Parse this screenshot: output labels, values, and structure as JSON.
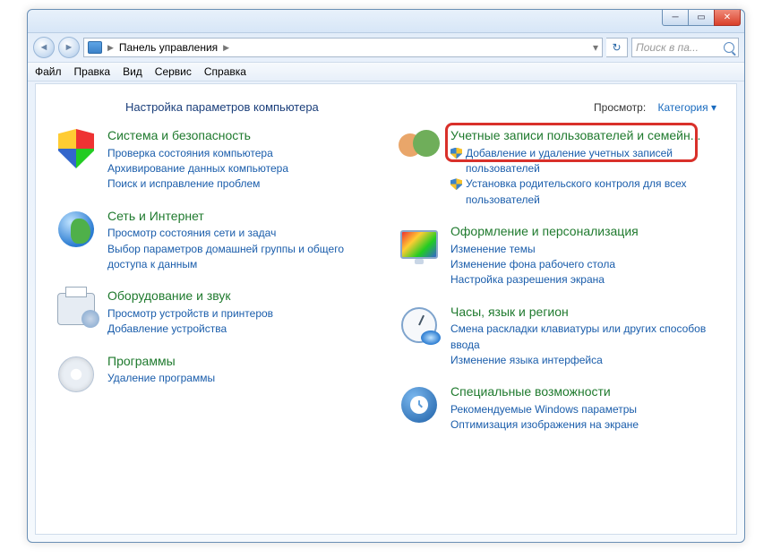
{
  "window": {
    "breadcrumb_title": "Панель управления",
    "search_placeholder": "Поиск в па..."
  },
  "menu": {
    "file": "Файл",
    "edit": "Правка",
    "view": "Вид",
    "tools": "Сервис",
    "help": "Справка"
  },
  "header": {
    "title": "Настройка параметров компьютера",
    "view_label": "Просмотр:",
    "view_value": "Категория"
  },
  "categories": {
    "system": {
      "title": "Система и безопасность",
      "links": [
        "Проверка состояния компьютера",
        "Архивирование данных компьютера",
        "Поиск и исправление проблем"
      ]
    },
    "network": {
      "title": "Сеть и Интернет",
      "links": [
        "Просмотр состояния сети и задач",
        "Выбор параметров домашней группы и общего доступа к данным"
      ]
    },
    "hardware": {
      "title": "Оборудование и звук",
      "links": [
        "Просмотр устройств и принтеров",
        "Добавление устройства"
      ]
    },
    "programs": {
      "title": "Программы",
      "links": [
        "Удаление программы"
      ]
    },
    "users": {
      "title": "Учетные записи пользователей и семейн...",
      "links": [
        "Добавление и удаление учетных записей пользователей",
        "Установка родительского контроля для всех пользователей"
      ]
    },
    "appearance": {
      "title": "Оформление и персонализация",
      "links": [
        "Изменение темы",
        "Изменение фона рабочего стола",
        "Настройка разрешения экрана"
      ]
    },
    "clock": {
      "title": "Часы, язык и регион",
      "links": [
        "Смена раскладки клавиатуры или других способов ввода",
        "Изменение языка интерфейса"
      ]
    },
    "ease": {
      "title": "Специальные возможности",
      "links": [
        "Рекомендуемые Windows параметры",
        "Оптимизация изображения на экране"
      ]
    }
  }
}
